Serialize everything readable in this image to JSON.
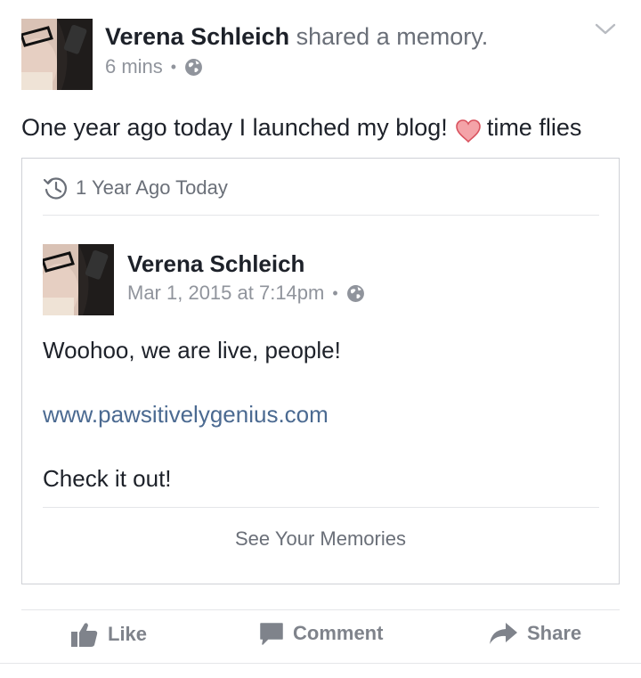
{
  "post": {
    "author": "Verena Schleich",
    "action": "shared a memory.",
    "time": "6 mins",
    "separator": "•",
    "privacy_icon": "globe-icon",
    "text_before_heart": "One year ago today I launched my blog!",
    "heart_icon": "heart-icon",
    "text_after_heart": "time flies"
  },
  "memory_card": {
    "header": "1 Year Ago Today",
    "header_icon": "history-icon",
    "shared_post": {
      "author": "Verena Schleich",
      "date": "Mar 1, 2015 at 7:14pm",
      "separator": "•",
      "privacy_icon": "globe-icon",
      "line1": "Woohoo, we are live, people!",
      "link": "www.pawsitivelygenius.com",
      "line3": "Check it out!"
    },
    "footer_link": "See Your Memories"
  },
  "actions": {
    "like": "Like",
    "comment": "Comment",
    "share": "Share"
  },
  "colors": {
    "name": "#1d2129",
    "secondary": "#90949c",
    "link": "#4b6a91",
    "heart_fill": "#f4a3a8",
    "heart_stroke": "#d9535f"
  }
}
